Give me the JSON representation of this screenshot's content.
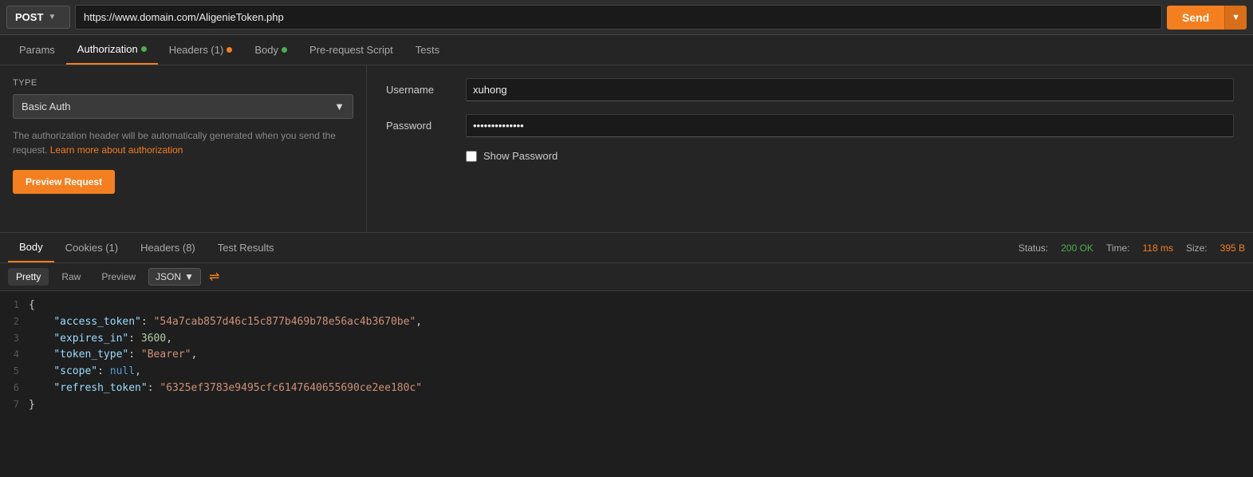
{
  "urlbar": {
    "method": "POST",
    "url": "https://www.domain.com/AligenieToken.php",
    "send_label": "Send"
  },
  "req_tabs": [
    {
      "id": "params",
      "label": "Params",
      "active": false,
      "dot": null
    },
    {
      "id": "authorization",
      "label": "Authorization",
      "active": true,
      "dot": "green"
    },
    {
      "id": "headers",
      "label": "Headers (1)",
      "active": false,
      "dot": "orange"
    },
    {
      "id": "body",
      "label": "Body",
      "active": false,
      "dot": "green"
    },
    {
      "id": "pre-request",
      "label": "Pre-request Script",
      "active": false,
      "dot": null
    },
    {
      "id": "tests",
      "label": "Tests",
      "active": false,
      "dot": null
    }
  ],
  "auth": {
    "type_label": "TYPE",
    "type_value": "Basic Auth",
    "description": "The authorization header will be automatically generated when you send the request.",
    "learn_more": "Learn more about authorization",
    "preview_btn": "Preview Request",
    "username_label": "Username",
    "username_value": "xuhong",
    "password_label": "Password",
    "password_value": "••••••••••••••",
    "show_password_label": "Show Password"
  },
  "resp_tabs": [
    {
      "id": "body",
      "label": "Body",
      "active": true
    },
    {
      "id": "cookies",
      "label": "Cookies (1)",
      "active": false
    },
    {
      "id": "headers",
      "label": "Headers (8)",
      "active": false
    },
    {
      "id": "test-results",
      "label": "Test Results",
      "active": false
    }
  ],
  "resp_status": {
    "status_label": "Status:",
    "status_value": "200 OK",
    "time_label": "Time:",
    "time_value": "118 ms",
    "size_label": "Size:",
    "size_value": "395 B"
  },
  "code_toolbar": {
    "pretty_label": "Pretty",
    "raw_label": "Raw",
    "preview_label": "Preview",
    "format_label": "JSON"
  },
  "code_lines": [
    {
      "num": 1,
      "content": "{"
    },
    {
      "num": 2,
      "key": "access_token",
      "value": "\"54a7cab857d46c15c877b469b78e56ac4b3670be\"",
      "type": "str",
      "comma": true
    },
    {
      "num": 3,
      "key": "expires_in",
      "value": "3600",
      "type": "num",
      "comma": true
    },
    {
      "num": 4,
      "key": "token_type",
      "value": "\"Bearer\"",
      "type": "str",
      "comma": true
    },
    {
      "num": 5,
      "key": "scope",
      "value": "null",
      "type": "null",
      "comma": true
    },
    {
      "num": 6,
      "key": "refresh_token",
      "value": "\"6325ef3783e9495cfc6147640655690ce2ee180c\"",
      "type": "str",
      "comma": false
    },
    {
      "num": 7,
      "content": "}"
    }
  ]
}
